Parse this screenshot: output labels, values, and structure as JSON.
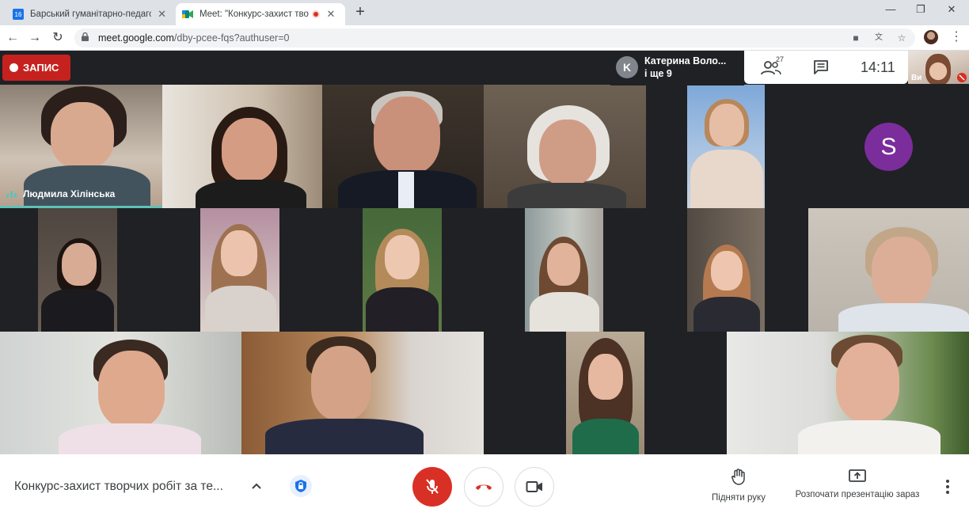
{
  "browser": {
    "tabs": [
      {
        "title": "Барський гуманітарно-педагогі",
        "favicon_text": "16",
        "favicon_color": "#1a73e8",
        "active": false
      },
      {
        "title": "Meet: \"Конкурс-захист творч",
        "favicon_color": "#00897b",
        "active": true,
        "recording": true
      }
    ],
    "url_host": "meet.google.com",
    "url_path": "/dby-pcee-fqs?authuser=0"
  },
  "meet": {
    "record_label": "ЗАПИС",
    "presenter": {
      "initial": "K",
      "name": "Катерина Воло...",
      "more": "і ще 9"
    },
    "people_count": "27",
    "clock": "14:11",
    "self_label": "Ви",
    "speaker_name": "Людмила Хілінська",
    "avatar_initial": "S",
    "accent_color": "#5ec2b7",
    "mic_color": "#d93025"
  },
  "bottom_bar": {
    "meeting_title": "Конкурс-захист творчих робіт за те...",
    "raise_hand_label": "Підняти руку",
    "present_label": "Розпочати презентацію зараз"
  }
}
